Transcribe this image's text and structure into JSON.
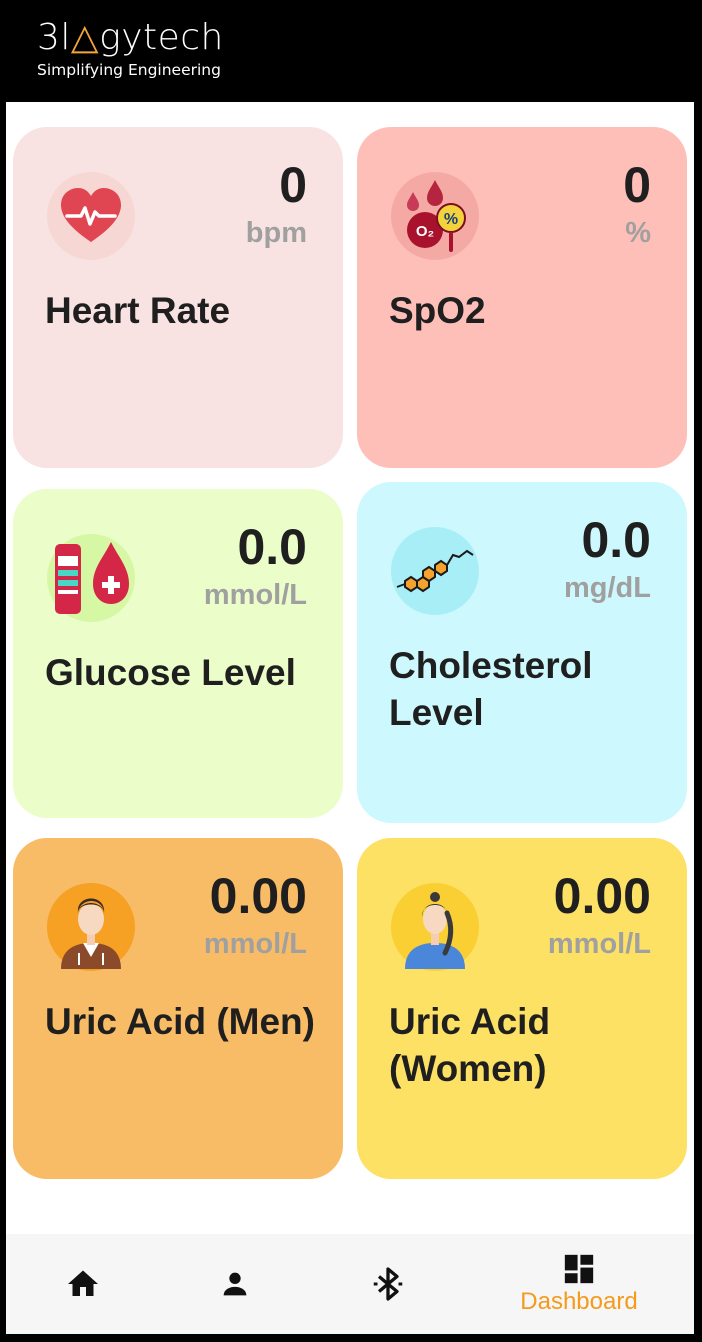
{
  "header": {
    "logo_prefix": "3l",
    "logo_accent": "△",
    "logo_suffix": "gytech",
    "tagline": "Simplifying Engineering"
  },
  "cards": [
    {
      "title": "Heart Rate",
      "value": "0",
      "unit": "bpm",
      "icon": "heart-rate-icon",
      "bg": "#f8e3e2"
    },
    {
      "title": "SpO2",
      "value": "0",
      "unit": "%",
      "icon": "spo2-icon",
      "bg": "#ffbfb9"
    },
    {
      "title": "Glucose Level",
      "value": "0.0",
      "unit": "mmol/L",
      "icon": "glucose-icon",
      "bg": "#ebfdc9"
    },
    {
      "title": "Cholesterol Level",
      "value": "0.0",
      "unit": "mg/dL",
      "icon": "cholesterol-icon",
      "bg": "#cdf8fd"
    },
    {
      "title": "Uric Acid (Men)",
      "value": "0.00",
      "unit": "mmol/L",
      "icon": "man-avatar-icon",
      "bg": "#f8bc66"
    },
    {
      "title": "Uric Acid (Women)",
      "value": "0.00",
      "unit": "mmol/L",
      "icon": "woman-avatar-icon",
      "bg": "#fde164"
    }
  ],
  "nav": {
    "items": [
      {
        "icon": "home-icon",
        "label": ""
      },
      {
        "icon": "person-icon",
        "label": ""
      },
      {
        "icon": "bluetooth-icon",
        "label": ""
      },
      {
        "icon": "dashboard-icon",
        "label": "Dashboard",
        "active": true
      }
    ],
    "active_color": "#f49a1d"
  }
}
